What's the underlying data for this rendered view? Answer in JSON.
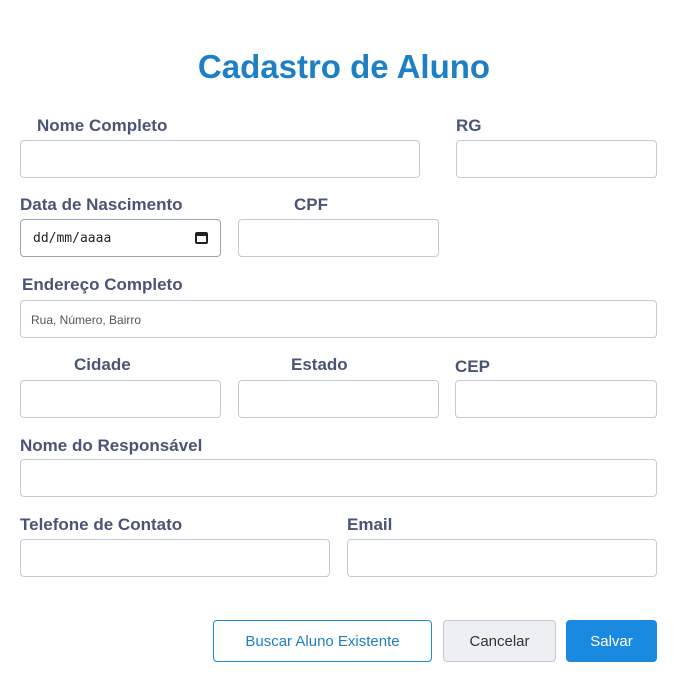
{
  "title": "Cadastro de Aluno",
  "fields": {
    "nome_completo": {
      "label": "Nome Completo",
      "value": "",
      "placeholder": ""
    },
    "rg": {
      "label": "RG",
      "value": "",
      "placeholder": ""
    },
    "data_nascimento": {
      "label": "Data de Nascimento",
      "display": "dd/mm/aaaa"
    },
    "cpf": {
      "label": "CPF",
      "value": "",
      "placeholder": ""
    },
    "endereco": {
      "label": "Endereço Completo",
      "value": "",
      "placeholder": "Rua, Número, Bairro"
    },
    "cidade": {
      "label": "Cidade",
      "value": "",
      "placeholder": ""
    },
    "estado": {
      "label": "Estado",
      "value": "",
      "placeholder": ""
    },
    "cep": {
      "label": "CEP",
      "value": "",
      "placeholder": ""
    },
    "responsavel": {
      "label": "Nome do Responsável",
      "value": "",
      "placeholder": ""
    },
    "telefone": {
      "label": "Telefone de Contato",
      "value": "",
      "placeholder": ""
    },
    "email": {
      "label": "Email",
      "value": "",
      "placeholder": ""
    }
  },
  "buttons": {
    "buscar": "Buscar Aluno Existente",
    "cancelar": "Cancelar",
    "salvar": "Salvar"
  },
  "colors": {
    "title": "#1e7fc4",
    "label": "#4a5575",
    "primary": "#1a8ae0"
  },
  "icons": {
    "date_picker": "calendar-icon"
  }
}
